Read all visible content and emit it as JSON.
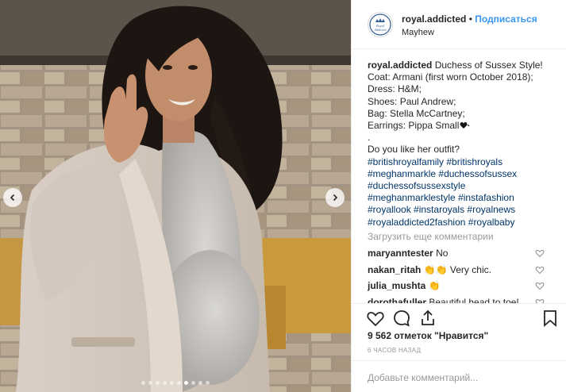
{
  "post": {
    "username": "royal.addicted",
    "separator": " • ",
    "follow_label": "Подписаться",
    "location": "Mayhew",
    "avatar_text": "Royal Addicted"
  },
  "caption": {
    "lines": [
      "Duchess of Sussex Style!",
      "Coat: Armani (first worn October 2018);",
      "Dress: H&M;",
      "Shoes: Paul Andrew;",
      "Bag: Stella McCartney;",
      "Earrings: Pippa Small",
      ".",
      "Do you like her outfit?",
      "#britishroyalfamily #britishroyals",
      "#meghanmarkle #duchessofsussex",
      "#duchessofsussexstyle",
      "#meghanmarklestyle #instafashion",
      "#royallook #instaroyals #royalnews",
      "#royaladdicted2fashion #royalbaby"
    ]
  },
  "load_more_label": "Загрузить еще комментарии",
  "comments": [
    {
      "user": "maryanntester",
      "text": "No"
    },
    {
      "user": "nakan_ritah",
      "text": "👏👏 Very chic."
    },
    {
      "user": "julia_mushta",
      "text": "👏"
    },
    {
      "user": "dorothafuller",
      "text": "Beautiful head to toe!"
    }
  ],
  "likes_label": "9 562 отметок \"Нравится\"",
  "time_label": "6 ЧАСОВ НАЗАД",
  "add_comment_placeholder": "Добавьте комментарий...",
  "carousel": {
    "total": 10,
    "active_index": 6
  },
  "colors": {
    "link": "#3897f0",
    "hashtag": "#003569",
    "muted": "#999999",
    "text": "#262626",
    "border": "#efefef"
  },
  "icons": [
    "heart-icon",
    "comment-icon",
    "share-icon",
    "bookmark-icon",
    "chevron-left-icon",
    "chevron-right-icon"
  ]
}
